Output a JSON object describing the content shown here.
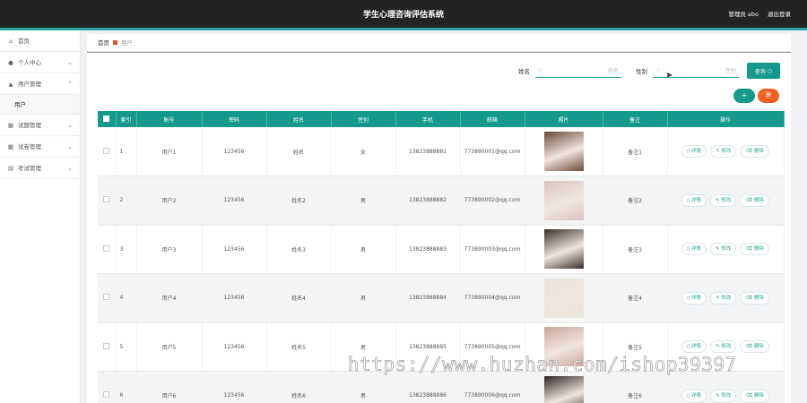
{
  "header": {
    "title": "学生心理咨询评估系统",
    "admin_label": "管理员 abo",
    "logout_label": "退出登录"
  },
  "sidebar": {
    "items": [
      {
        "label": "首页",
        "icon": "home-icon"
      },
      {
        "label": "个人中心",
        "icon": "user-icon"
      },
      {
        "label": "用户管理",
        "icon": "users-icon",
        "sub": "用户"
      },
      {
        "label": "试题管理",
        "icon": "grid-icon"
      },
      {
        "label": "试卷管理",
        "icon": "grid-icon"
      },
      {
        "label": "考试管理",
        "icon": "doc-icon"
      }
    ]
  },
  "breadcrumb": {
    "home": "首页",
    "current": "用户"
  },
  "search": {
    "name_label": "姓名",
    "name_placeholder": "姓名",
    "gender_label": "性别",
    "gender_placeholder": "性别",
    "query_label": "查询"
  },
  "actions": {
    "add_label": "+",
    "delete_label": "删"
  },
  "table": {
    "headers": [
      "",
      "索引",
      "账号",
      "密码",
      "姓名",
      "性别",
      "手机",
      "邮箱",
      "照片",
      "备注",
      "操作"
    ],
    "rows": [
      {
        "index": "1",
        "account": "用户1",
        "password": "123456",
        "name": "姓名",
        "gender": "女",
        "phone": "13823888881",
        "email": "773890001@qq.com",
        "note": "备注1",
        "photo_color": "#6b4a3a"
      },
      {
        "index": "2",
        "account": "用户2",
        "password": "123456",
        "name": "姓名2",
        "gender": "男",
        "phone": "13823888882",
        "email": "773890002@qq.com",
        "note": "备注2",
        "photo_color": "#d9c6c0"
      },
      {
        "index": "3",
        "account": "用户3",
        "password": "123456",
        "name": "姓名3",
        "gender": "男",
        "phone": "13823888883",
        "email": "773890003@qq.com",
        "note": "备注3",
        "photo_color": "#3a2e2a"
      },
      {
        "index": "4",
        "account": "用户4",
        "password": "123456",
        "name": "姓名4",
        "gender": "男",
        "phone": "13823888884",
        "email": "773890004@qq.com",
        "note": "备注4",
        "photo_color": "#e8e4dc"
      },
      {
        "index": "5",
        "account": "用户5",
        "password": "123456",
        "name": "姓名5",
        "gender": "男",
        "phone": "13823888885",
        "email": "773890005@qq.com",
        "note": "备注5",
        "photo_color": "#c9a79b"
      },
      {
        "index": "6",
        "account": "用户6",
        "password": "123456",
        "name": "姓名6",
        "gender": "男",
        "phone": "13823888886",
        "email": "773890006@qq.com",
        "note": "备注6",
        "photo_color": "#2a2422"
      }
    ],
    "op_detail": "详情",
    "op_edit": "修改",
    "op_delete": "删除"
  },
  "watermark": "https://www.huzhan.com/ishop39397",
  "colors": {
    "accent": "#14998c",
    "danger": "#f06223",
    "topbar": "#232323"
  }
}
